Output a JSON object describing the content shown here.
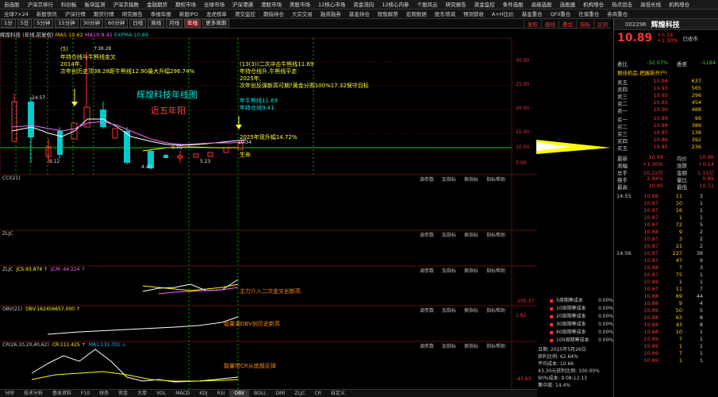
{
  "menu_top": [
    "自选股",
    "沪深京排行",
    "科创板",
    "板块监测",
    "沪深京指数",
    "金融期货",
    "期权市场",
    "全球市场",
    "沪深港通",
    "港股市场",
    "美股市场",
    "12核心市场",
    "资金流向",
    "12核心内参",
    "个股风云",
    "研究报告",
    "资金监控",
    "条件选股",
    "高级选股",
    "选股器",
    "机构增仓",
    "热点追击",
    "高低长线",
    "机构增仓"
  ],
  "menu_second": [
    "全球7×24",
    "新股快讯",
    "沪深行情",
    "期货行情",
    "研究报告",
    "季报年报",
    "新股IPO",
    "龙虎榜单",
    "港交监控",
    "期指持仓",
    "大宗交易",
    "融资融券",
    "基金持仓",
    "限售解禁",
    "宏观数据",
    "股东增减",
    "预测营收",
    "A+H比价",
    "基金重仓",
    "QFII重仓",
    "社保重仓",
    "券商重仓"
  ],
  "toolbar": {
    "periods": [
      "1分",
      "5日",
      "5分钟",
      "15分钟",
      "30分钟",
      "60分钟",
      "日线",
      "周线",
      "月线",
      "年线",
      "更多周期"
    ],
    "active_period": "年线",
    "right_items": [
      "复权",
      "画线",
      "叠加",
      "指标",
      "区间"
    ]
  },
  "main_info": {
    "name": "辉煌科技",
    "period": "(年线,前复权)",
    "t1": "MA5:10.62",
    "t2": "MA10:9.41",
    "t3": "EXPMA:10.89"
  },
  "annotations": {
    "a1": "(5)",
    "a1b": "↑38.28",
    "a2": "年持仓线与牛熊线金叉",
    "a3": "2014年,",
    "a4": "次年创历史顶38.28距牛熊线12.90最大升幅296.74%",
    "a5": "(13(3))二次冲击牛熊线11.69",
    "a6": "年持仓线升,牛熊线平走",
    "a7": "2025年,",
    "a8": "次年创反弹新高可期?黄金分割100%17.32保守目标",
    "title1": "辉煌科技年线图",
    "title2": "近五年阳",
    "a9": "年牛熊线11.69",
    "a10": "年持仓线9.41",
    "a11": "2025年现升幅14.72%",
    "a12": "生命",
    "low1": "4.40",
    "low2": "5.23",
    "high1": "24.57",
    "cur": "10.34",
    "l3": "9.75",
    "l4": "9.12",
    "sub1": "主力介入二次金叉创新高",
    "sub2": "能量潮OBV创历史新高",
    "sub3": "能量带CR从底部反弹"
  },
  "sub_panels": [
    {
      "label": "CCI(21)",
      "v1": "",
      "v2": "",
      "v3": ""
    },
    {
      "label": "ZLJC",
      "v1": "",
      "v2": "",
      "v3": ""
    },
    {
      "label": "ZLJC",
      "v1": "JCS:93.874 ↑",
      "v2": "JCM:-44.224 ↑",
      "v3": ""
    },
    {
      "label": "OBV(21)",
      "v1": "OBV:162456657.000 ↑",
      "v2": "",
      "v3": ""
    },
    {
      "label": "CR(26,10,20,40,62)",
      "v1": "CR:111.425 ↑",
      "v2": "MA1:131.701 ↓",
      "v3": ""
    }
  ],
  "panel_tools": [
    "调参数",
    "加指标",
    "换指标",
    "指标帮助"
  ],
  "axis": {
    "main": [
      "30.00",
      "25.00",
      "20.00",
      "15.00",
      "10.00",
      "5.00",
      "0.00"
    ],
    "sub_jc": "-105.37",
    "sub_obv": "1.62",
    "sub_cr": "-45.63"
  },
  "stock": {
    "code": "002296",
    "name": "辉煌科技",
    "price": "10.89",
    "chg": "+0.14",
    "pct": "+1.30%",
    "status": "已收市"
  },
  "weibi": {
    "label1": "委比",
    "val1": "-32.07%",
    "label2": "委差",
    "val2": "-1184"
  },
  "quick": "据佳机会,把握新开户!",
  "asks": [
    {
      "l": "卖五",
      "p": "10.94",
      "v": "637"
    },
    {
      "l": "卖四",
      "p": "10.93",
      "v": "565"
    },
    {
      "l": "卖三",
      "p": "10.92",
      "v": "296"
    },
    {
      "l": "卖二",
      "p": "10.91",
      "v": "454"
    },
    {
      "l": "卖一",
      "p": "10.90",
      "v": "488"
    }
  ],
  "bids": [
    {
      "l": "买一",
      "p": "10.89",
      "v": "99"
    },
    {
      "l": "买二",
      "p": "10.88",
      "v": "389"
    },
    {
      "l": "买三",
      "p": "10.87",
      "v": "138"
    },
    {
      "l": "买四",
      "p": "10.86",
      "v": "392"
    },
    {
      "l": "买五",
      "p": "10.85",
      "v": "236"
    }
  ],
  "stats": [
    {
      "a": "最新",
      "av": "10.89",
      "b": "均价",
      "bv": "10.86"
    },
    {
      "a": "涨幅",
      "av": "+1.30%",
      "b": "涨跌",
      "bv": "+0.14"
    },
    {
      "a": "总手",
      "av": "10.22万",
      "b": "金额",
      "bv": "1.11亿"
    },
    {
      "a": "换手",
      "av": "2.94%",
      "b": "量比",
      "bv": "0.89"
    },
    {
      "a": "最高",
      "av": "10.95",
      "b": "最低",
      "bv": "10.72"
    }
  ],
  "ticks": [
    {
      "t": "14:55",
      "p": "10.88",
      "v": "11",
      "n": "3"
    },
    {
      "t": "",
      "p": "10.87",
      "v": "10",
      "n": "1"
    },
    {
      "t": "",
      "p": "10.87",
      "v": "16",
      "n": "1"
    },
    {
      "t": "",
      "p": "10.87",
      "v": "1",
      "n": "1"
    },
    {
      "t": "",
      "p": "10.87",
      "v": "72",
      "n": "5"
    },
    {
      "t": "",
      "p": "10.88",
      "v": "9",
      "n": "2"
    },
    {
      "t": "",
      "p": "10.87",
      "v": "3",
      "n": "2"
    },
    {
      "t": "",
      "p": "10.87",
      "v": "21",
      "n": "2"
    },
    {
      "t": "14:56",
      "p": "10.87",
      "v": "227",
      "n": "38"
    },
    {
      "t": "",
      "p": "10.87",
      "v": "47",
      "n": "9"
    },
    {
      "t": "",
      "p": "10.88",
      "v": "7",
      "n": "3"
    },
    {
      "t": "",
      "p": "10.87",
      "v": "75",
      "n": "1"
    },
    {
      "t": "",
      "p": "10.88",
      "v": "1",
      "n": "1"
    },
    {
      "t": "",
      "p": "10.87",
      "v": "11",
      "n": "7"
    },
    {
      "t": "",
      "p": "10.88",
      "v": "69",
      "n": "44"
    },
    {
      "t": "",
      "p": "10.88",
      "v": "9",
      "n": "4"
    },
    {
      "t": "",
      "p": "10.89",
      "v": "50",
      "n": "5"
    },
    {
      "t": "",
      "p": "10.88",
      "v": "63",
      "n": "8"
    },
    {
      "t": "",
      "p": "10.88",
      "v": "43",
      "n": "8"
    },
    {
      "t": "",
      "p": "10.88",
      "v": "10",
      "n": "1"
    },
    {
      "t": "",
      "p": "10.89",
      "v": "7",
      "n": "1"
    },
    {
      "t": "",
      "p": "10.89",
      "v": "1",
      "n": "1"
    },
    {
      "t": "",
      "p": "10.89",
      "v": "7",
      "n": "1"
    },
    {
      "t": "",
      "p": "10.89",
      "v": "1",
      "n": "1"
    }
  ],
  "legend": [
    {
      "name": "5周期筹成本",
      "pct": "0.00%"
    },
    {
      "name": "10周期筹成本",
      "pct": "0.00%"
    },
    {
      "name": "20周期筹成本",
      "pct": "0.00%"
    },
    {
      "name": "30周期筹成本",
      "pct": "0.00%"
    },
    {
      "name": "60周期筹成本",
      "pct": "0.00%"
    },
    {
      "name": "100周期筹成本",
      "pct": "0.00%"
    }
  ],
  "info": {
    "date": "日期: 2025年5月26日",
    "profit": "获利比例: 62.64%",
    "cost_lbl": "平均成本: 10.66",
    "range": "43.30元获利比例: 100.00%",
    "cost90": "90%成本: 9.08-12.13",
    "conc": "集中度: 14.4%"
  },
  "bottom_tabs": [
    "分时",
    "技术分析",
    "基本资料",
    "F10",
    "财务",
    "资金",
    "大单",
    "VOL",
    "MACD",
    "KDJ",
    "RSI",
    "OBV",
    "BOLL",
    "DMI",
    "ZLJC",
    "CR",
    "自定义"
  ],
  "active_bottom": "OBV"
}
